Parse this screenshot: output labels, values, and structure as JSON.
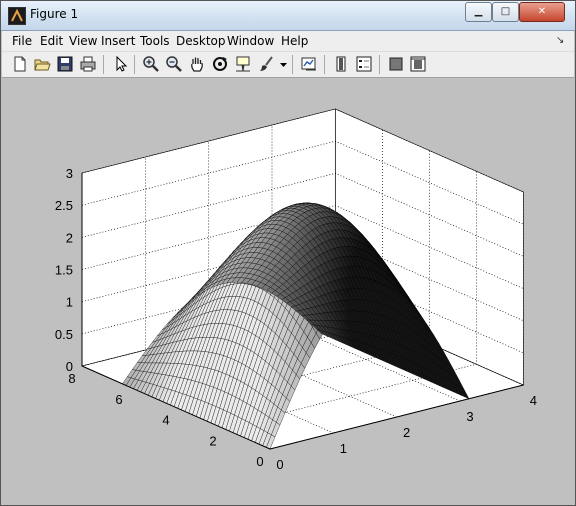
{
  "window": {
    "title": "Figure 1"
  },
  "menu": [
    {
      "label": "File"
    },
    {
      "label": "Edit"
    },
    {
      "label": "View"
    },
    {
      "label": "Insert"
    },
    {
      "label": "Tools"
    },
    {
      "label": "Desktop"
    },
    {
      "label": "Window"
    },
    {
      "label": "Help"
    }
  ],
  "toolbar_icons": [
    "new-figure-icon",
    "open-file-icon",
    "save-icon",
    "print-icon",
    "edit-plot-arrow-icon",
    "zoom-in-icon",
    "zoom-out-icon",
    "pan-hand-icon",
    "rotate-3d-icon",
    "data-cursor-icon",
    "brush-icon",
    "brush-dropdown-icon",
    "link-plot-icon",
    "colorbar-icon",
    "legend-icon",
    "hide-plot-tools-icon",
    "show-plot-tools-icon"
  ],
  "chart_data": {
    "type": "surface",
    "colormap": "gray",
    "grid": true,
    "x_ticks": [
      "0",
      "1",
      "2",
      "3",
      "4"
    ],
    "y_ticks": [
      "0",
      "2",
      "4",
      "6",
      "8"
    ],
    "z_ticks": [
      "0",
      "0.5",
      "1",
      "1.5",
      "2",
      "2.5",
      "3"
    ],
    "xlim": [
      0,
      4
    ],
    "ylim": [
      0,
      8
    ],
    "zlim": [
      0,
      3
    ],
    "x_domain": [
      0,
      3.1416
    ],
    "y_domain": [
      0,
      6.2832
    ],
    "z_peak": 3
  }
}
